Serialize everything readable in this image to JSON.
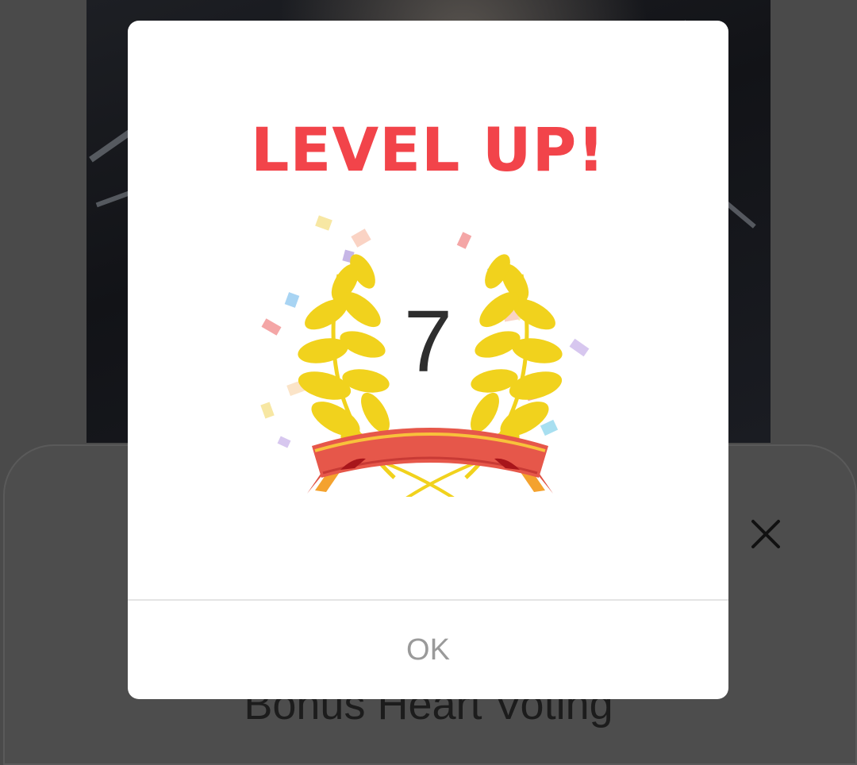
{
  "background": {
    "section_title": "Bonus Heart Voting",
    "close_icon": "close-icon"
  },
  "dialog": {
    "title": "LEVEL UP!",
    "level": "7",
    "ok_label": "OK",
    "title_color": "#f2444a",
    "wreath_icon": "laurel-wreath-icon"
  }
}
